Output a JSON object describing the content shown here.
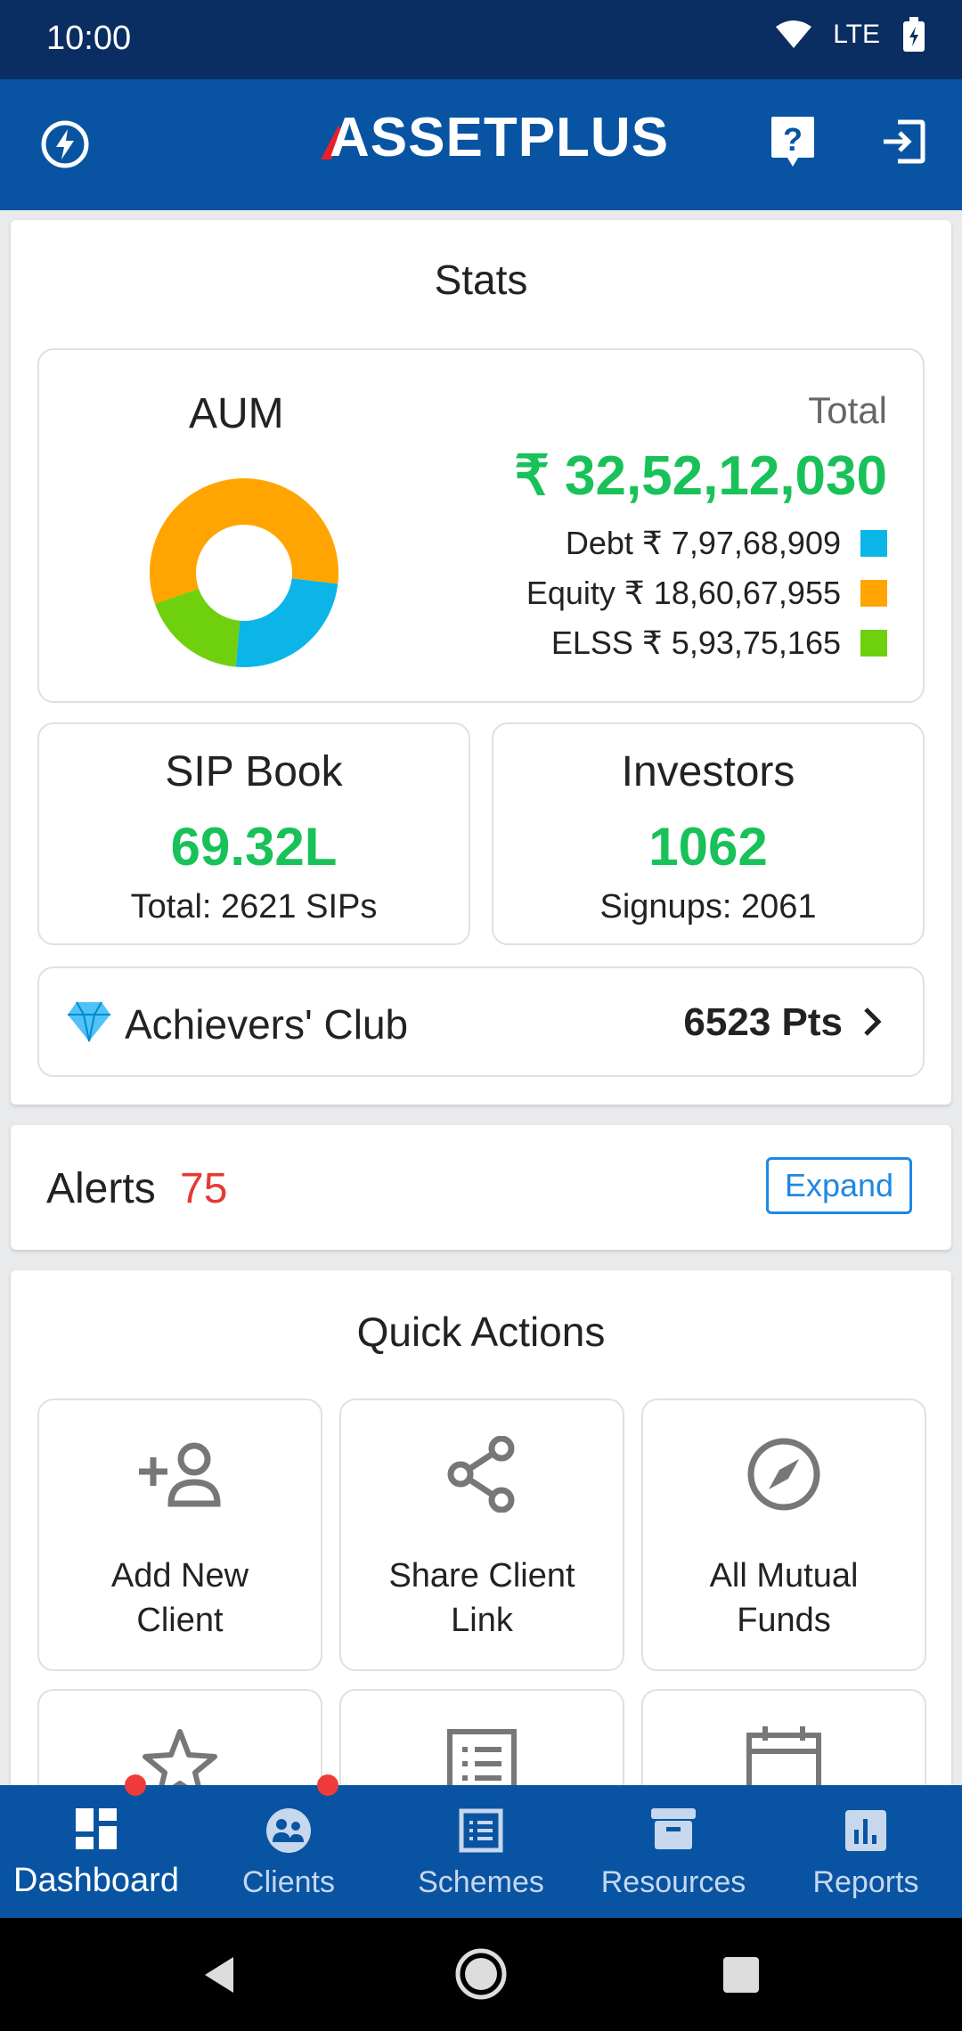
{
  "status_bar": {
    "time": "10:00",
    "network": "LTE"
  },
  "app_bar": {
    "logo": "ASSETPLUS"
  },
  "stats": {
    "title": "Stats",
    "aum": {
      "label": "AUM",
      "total_label": "Total",
      "total_value": "₹ 32,52,12,030",
      "legend": [
        {
          "label": "Debt ₹ 7,97,68,909",
          "color": "#0bb5e8"
        },
        {
          "label": "Equity ₹ 18,60,67,955",
          "color": "#ffa400"
        },
        {
          "label": "ELSS ₹ 5,93,75,165",
          "color": "#6fd00e"
        }
      ]
    },
    "sip_book": {
      "title": "SIP Book",
      "value": "69.32L",
      "sub": "Total: 2621 SIPs"
    },
    "investors": {
      "title": "Investors",
      "value": "1062",
      "sub": "Signups: 2061"
    },
    "achievers": {
      "label": "Achievers' Club",
      "points": "6523 Pts"
    }
  },
  "alerts": {
    "label": "Alerts",
    "count": "75",
    "expand_label": "Expand"
  },
  "quick_actions": {
    "title": "Quick Actions",
    "items": [
      {
        "line1": "Add New",
        "line2": "Client",
        "icon": "add-person-icon"
      },
      {
        "line1": "Share Client",
        "line2": "Link",
        "icon": "share-icon"
      },
      {
        "line1": "All Mutual",
        "line2": "Funds",
        "icon": "compass-icon"
      }
    ]
  },
  "bottom_nav": {
    "items": [
      {
        "label": "Dashboard",
        "icon": "dashboard-icon",
        "active": true
      },
      {
        "label": "Clients",
        "icon": "clients-icon"
      },
      {
        "label": "Schemes",
        "icon": "schemes-icon"
      },
      {
        "label": "Resources",
        "icon": "resources-icon"
      },
      {
        "label": "Reports",
        "icon": "reports-icon"
      }
    ]
  },
  "colors": {
    "primary": "#0854a2",
    "status_bar": "#0a2d62",
    "accent_green": "#19c159",
    "alert_red": "#e53935",
    "expand_blue": "#1e88e5"
  },
  "chart_data": {
    "type": "pie",
    "categories": [
      "Debt",
      "Equity",
      "ELSS"
    ],
    "values": [
      79768909,
      186067955,
      59375165
    ]
  }
}
